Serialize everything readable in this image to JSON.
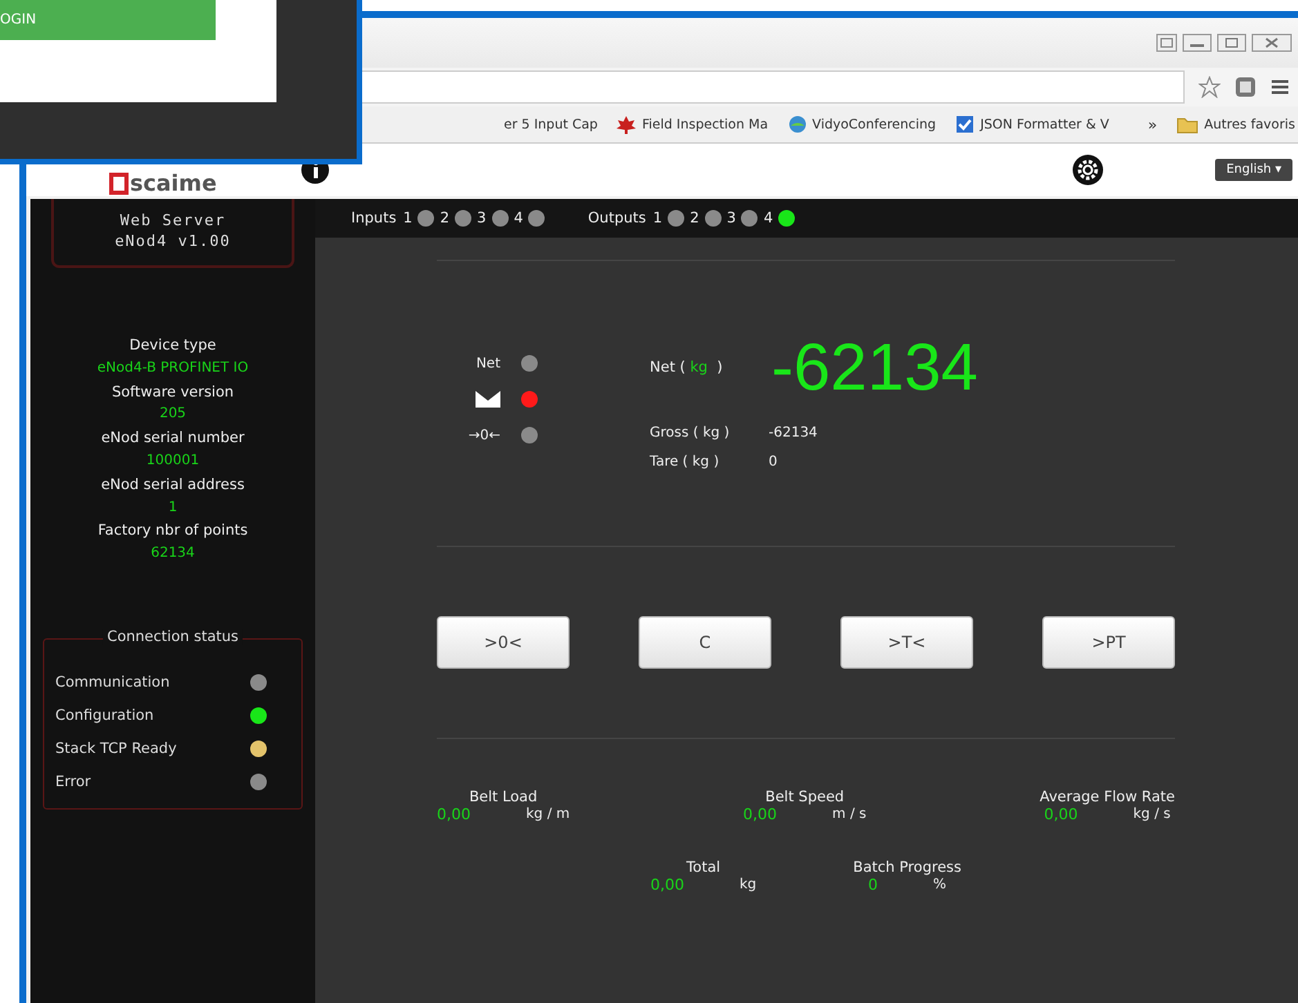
{
  "login_window": {
    "button": "OGIN"
  },
  "bookmarks": [
    {
      "label": "er 5 Input Cap"
    },
    {
      "label": "Field Inspection Ma"
    },
    {
      "label": "VidyoConferencing"
    },
    {
      "label": "JSON Formatter & V"
    }
  ],
  "bookmarks_more": "»",
  "other_bookmarks": "Autres favoris",
  "header": {
    "logo": "scaime",
    "language": "English ▾"
  },
  "sidebar": {
    "title": [
      "Web Server",
      "eNod4 v1.00"
    ],
    "device_info": [
      {
        "label": "Device type",
        "value": "eNod4-B PROFINET IO"
      },
      {
        "label": "Software version",
        "value": "205"
      },
      {
        "label": "eNod serial number",
        "value": "100001"
      },
      {
        "label": "eNod serial address",
        "value": "1"
      },
      {
        "label": "Factory nbr of points",
        "value": "62134"
      }
    ],
    "connection_status": {
      "title": "Connection status",
      "items": [
        {
          "label": "Communication",
          "color": "#8a8a8a"
        },
        {
          "label": "Configuration",
          "color": "#19e619"
        },
        {
          "label": "Stack TCP Ready",
          "color": "#e3c36b"
        },
        {
          "label": "Error",
          "color": "#8a8a8a"
        }
      ]
    }
  },
  "io_bar": [
    {
      "label": "Inputs",
      "channels": [
        {
          "number": "1",
          "on": false
        },
        {
          "number": "2",
          "on": false
        },
        {
          "number": "3",
          "on": false
        },
        {
          "number": "4",
          "on": false
        }
      ]
    },
    {
      "label": "Outputs",
      "channels": [
        {
          "number": "1",
          "on": false
        },
        {
          "number": "2",
          "on": false
        },
        {
          "number": "3",
          "on": false
        },
        {
          "number": "4",
          "on": true
        }
      ]
    }
  ],
  "indicators": [
    {
      "kind": "text",
      "label": "Net",
      "color": "#8a8a8a"
    },
    {
      "kind": "icon",
      "color": "#ff1a1a"
    },
    {
      "kind": "text",
      "label": "→0←",
      "color": "#8a8a8a"
    }
  ],
  "net": {
    "prefix": "Net (",
    "unit": "kg",
    "suffix": ")",
    "value": "-62134"
  },
  "readings": [
    {
      "label": "Gross ( kg )",
      "value": "-62134"
    },
    {
      "label": "Tare ( kg )",
      "value": "0"
    }
  ],
  "buttons": [
    ">0<",
    "C",
    ">T<",
    ">PT"
  ],
  "measures": [
    [
      {
        "label": "Belt Load",
        "value": "0,00",
        "unit": "kg / m"
      },
      {
        "label": "Belt Speed",
        "value": "0,00",
        "unit": "m / s"
      },
      {
        "label": "Average Flow Rate",
        "value": "0,00",
        "unit": "kg / s"
      }
    ],
    [
      {
        "label": "Total",
        "value": "0,00",
        "unit": "kg"
      },
      {
        "label": "Batch Progress",
        "value": "0",
        "unit": "%"
      }
    ]
  ]
}
